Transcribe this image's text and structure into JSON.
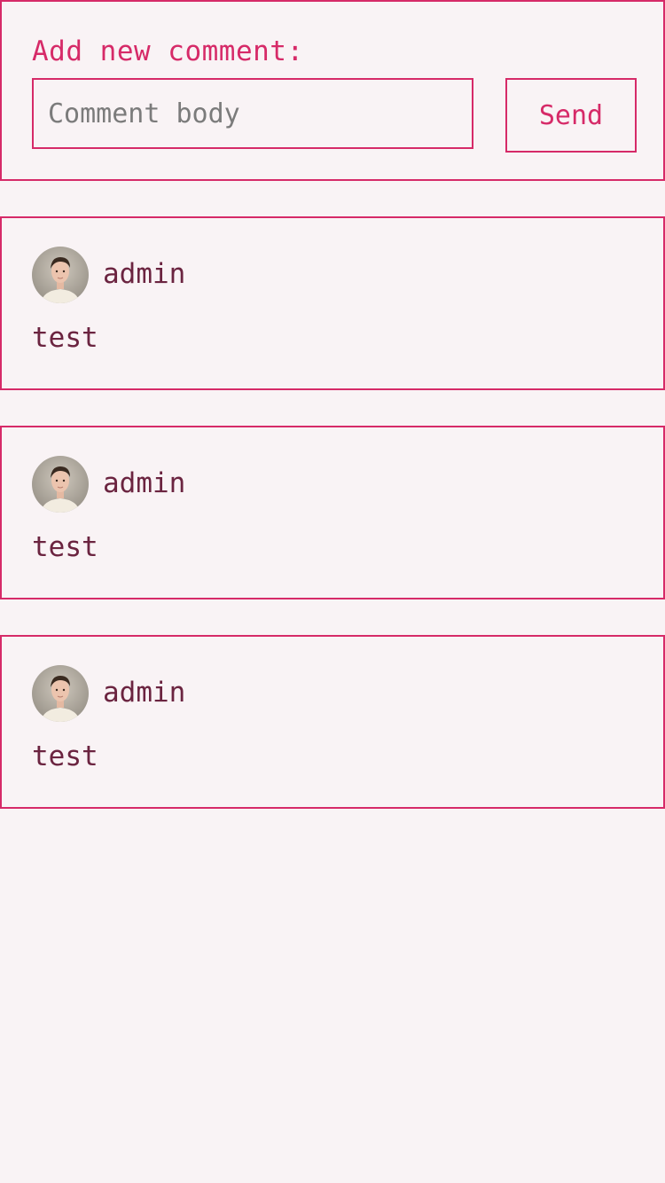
{
  "new_comment": {
    "title": "Add new comment:",
    "input_placeholder": "Comment body",
    "input_value": "",
    "send_label": "Send"
  },
  "comments": [
    {
      "author": "admin",
      "body": "test",
      "avatar_icon": "user-avatar-photo"
    },
    {
      "author": "admin",
      "body": "test",
      "avatar_icon": "user-avatar-photo"
    },
    {
      "author": "admin",
      "body": "test",
      "avatar_icon": "user-avatar-photo"
    }
  ],
  "colors": {
    "accent": "#d62a68",
    "text": "#6b2440",
    "background": "#f9f3f5",
    "placeholder": "#7b7b7b"
  }
}
